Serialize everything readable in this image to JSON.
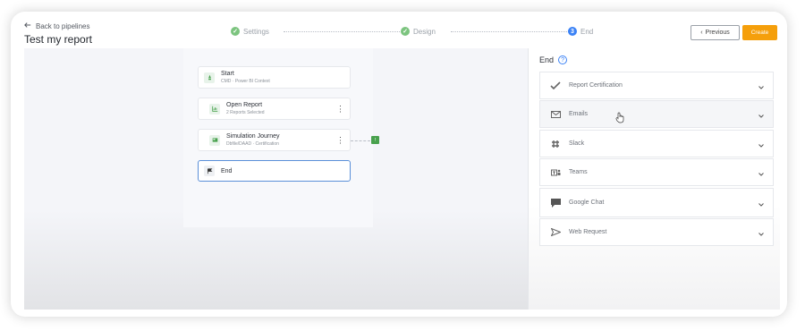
{
  "header": {
    "back_label": "Back to pipelines",
    "title": "Test my report",
    "previous_label": "Previous",
    "create_label": "Create"
  },
  "stepper": {
    "steps": [
      {
        "label": "Settings",
        "state": "done",
        "color": "#4aaa52"
      },
      {
        "label": "Design",
        "state": "done",
        "color": "#4aaa52"
      },
      {
        "label": "End",
        "state": "active",
        "number": "3",
        "color": "#3b82f6"
      }
    ]
  },
  "canvas": {
    "nodes": [
      {
        "title": "Start",
        "subtitle": "CMD · Power BI Context",
        "icon": "rocket-icon"
      },
      {
        "title": "Open Report",
        "subtitle": "2 Reports Selected",
        "icon": "report-icon"
      },
      {
        "title": "Simulation Journey",
        "subtitle": "Dbfile/DAAD · Certification",
        "icon": "simulation-icon"
      },
      {
        "title": "End",
        "subtitle": "",
        "icon": "flag-icon"
      }
    ]
  },
  "panel": {
    "title": "End",
    "sections": [
      {
        "label": "Report Certification",
        "icon": "check-icon"
      },
      {
        "label": "Emails",
        "icon": "mail-icon"
      },
      {
        "label": "Slack",
        "icon": "slack-icon"
      },
      {
        "label": "Teams",
        "icon": "teams-icon"
      },
      {
        "label": "Google Chat",
        "icon": "chat-icon"
      },
      {
        "label": "Web Request",
        "icon": "send-icon"
      }
    ]
  },
  "colors": {
    "accent": "#f59f0b",
    "success": "#4aaa52",
    "primary": "#3b82f6"
  }
}
